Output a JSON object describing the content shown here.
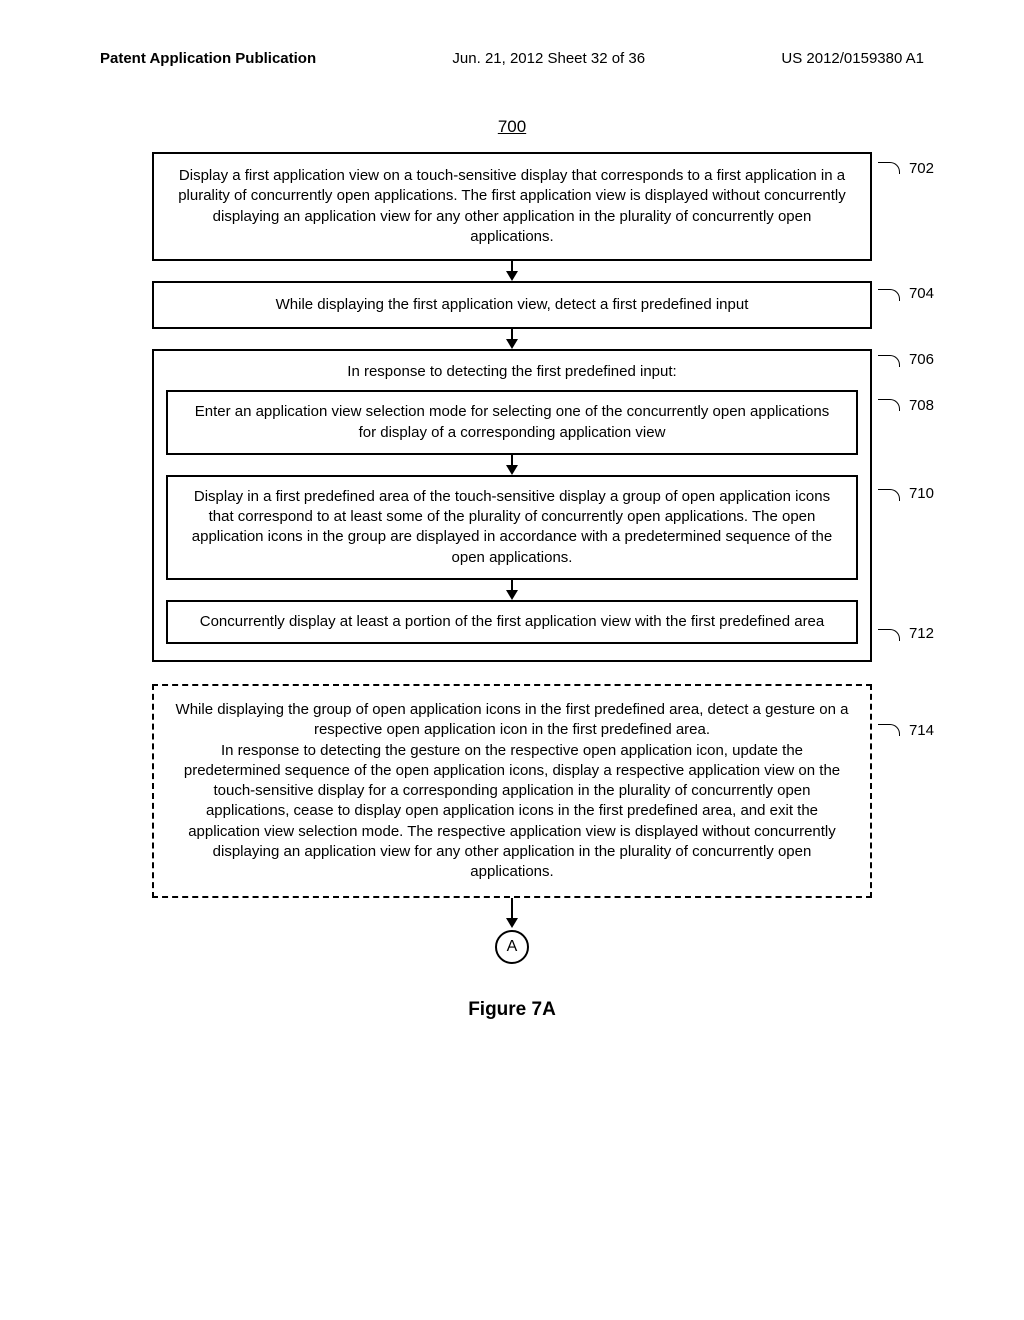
{
  "header": {
    "left": "Patent Application Publication",
    "center": "Jun. 21, 2012  Sheet 32 of 36",
    "right": "US 2012/0159380 A1"
  },
  "figure_number": "700",
  "boxes": {
    "b702": {
      "text": "Display a first application view on a touch-sensitive display that corresponds to a first application in a plurality of concurrently open applications.  The first application view is displayed without concurrently displaying an application view for any other application in the plurality of concurrently open applications.",
      "ref": "702"
    },
    "b704": {
      "text": "While displaying the first application view, detect a first predefined input",
      "ref": "704"
    },
    "b706": {
      "title": "In response to detecting the first predefined input:",
      "ref": "706"
    },
    "b708": {
      "text": "Enter an application view selection mode for selecting one of the concurrently open applications for display of a corresponding application view",
      "ref": "708"
    },
    "b710": {
      "text": "Display in a first predefined area of the touch-sensitive display a group of open application icons that correspond to at least some of the plurality of concurrently open applications.  The open application icons in the group are displayed in accordance with a predetermined sequence of the open applications.",
      "ref": "710"
    },
    "b712": {
      "text": "Concurrently display at least a portion of the first application view with the first predefined area",
      "ref": "712"
    },
    "b714": {
      "text": "While displaying the group of open application icons in the first predefined area, detect a gesture on a respective open application icon in the first predefined area.\nIn response to detecting the gesture on the respective open application icon, update the predetermined sequence of the open application icons, display a respective application view on the touch-sensitive display for a corresponding application in the plurality of concurrently open applications, cease to display open application icons in the first predefined area, and exit the application view selection mode.  The respective application view is displayed without concurrently displaying an application view for any other application in the plurality of concurrently open applications.",
      "ref": "714"
    }
  },
  "connector": "A",
  "figure_caption": "Figure 7A"
}
